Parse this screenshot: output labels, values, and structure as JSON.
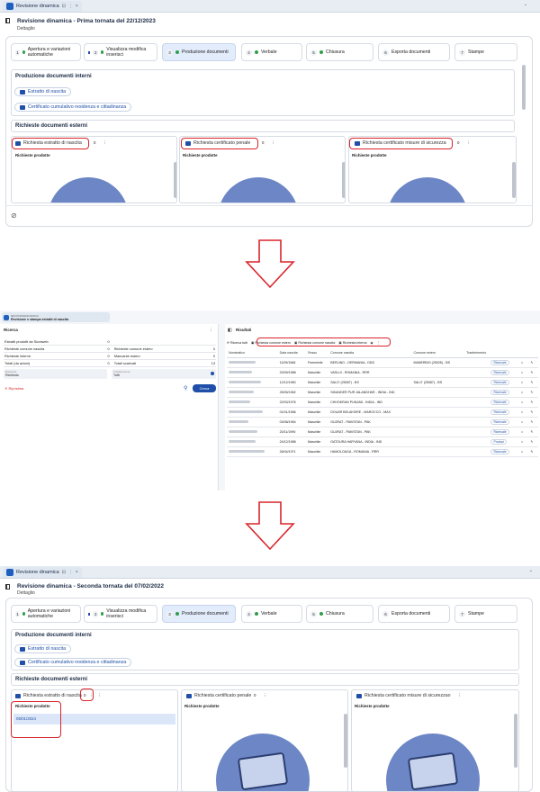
{
  "window": {
    "tab_title": "Revisione dinamica",
    "close": "×",
    "pin": "⊡",
    "more": "⋮",
    "chevron": "⌄"
  },
  "colors": {
    "accent": "#1f4fa8",
    "highlight": "#d9252c",
    "success": "#2e9d4b",
    "illustration": "#6c86c6"
  },
  "top": {
    "title": "Revisione dinamica - Prima tornata del 22/12/2023",
    "subtitle": "Dettaglio",
    "steps": [
      {
        "num": "1",
        "label": "Apertura e variazioni automatiche",
        "state": "ok"
      },
      {
        "num": "2",
        "label": "Visualizza modifica inserisci",
        "state": "ok"
      },
      {
        "num": "3",
        "label": "Produzione documenti",
        "state": "ok"
      },
      {
        "num": "4",
        "label": "Verbale",
        "state": "ok"
      },
      {
        "num": "5",
        "label": "Chiusura",
        "state": "ok"
      },
      {
        "num": "6",
        "label": "Esporta documenti",
        "state": ""
      },
      {
        "num": "7",
        "label": "Stampe",
        "state": ""
      }
    ],
    "internal_title": "Produzione documenti interni",
    "internal_buttons": [
      "Estratto di nascita",
      "Certificato cumulativo residenza e cittadinanza"
    ],
    "external_title": "Richieste documenti esterni",
    "external": [
      {
        "label": "Richiesta estratto di nascita",
        "count": "0",
        "produced": "Richieste prodotte"
      },
      {
        "label": "Richiesta certificato penale",
        "count": "0",
        "produced": "Richieste prodotte"
      },
      {
        "label": "Richiesta certificato misure di sicurezza",
        "count": "0",
        "produced": "Richieste prodotte"
      }
    ]
  },
  "middle": {
    "app_small": "REVISIONEDINAMICA",
    "app_title": "Revisione e stampa estratti di nascita",
    "search_title": "Ricerca",
    "results_title": "Risultati",
    "filters": [
      {
        "label": "Estratti prodotti da Sicraweb",
        "value": "0",
        "label2": "",
        "value2": ""
      },
      {
        "label": "Richieste comune nascita",
        "value": "0",
        "label2": "Richieste comune estero",
        "value2": "0"
      },
      {
        "label": "Richieste interne",
        "value": "0",
        "label2": "Mancante estero",
        "value2": "0"
      },
      {
        "label": "Totali (da azioni)",
        "value": "0",
        "label2": "Totali scaricati",
        "value2": "13"
      }
    ],
    "select1": {
      "label": "Richiesto",
      "value": "Richiesto"
    },
    "select2": {
      "label": "Trasferimento",
      "value": "Tutti"
    },
    "reset_label": "Ripristina",
    "search_label": "Cerca",
    "toolbar": {
      "ricercale": "Ricerca tutti",
      "btn1": "Richiesta comune estero",
      "btn2": "Richiesta comune nascita",
      "btn3": "Richiesta interna"
    },
    "columns": [
      "Nominativo",
      "Data nascita",
      "Sesso",
      "Comune nascita",
      "Comune estero",
      "Trasferimento",
      "",
      "",
      ""
    ],
    "rows": [
      {
        "date": "11/09/1966",
        "sex": "Femminile",
        "place": "BERLINO - GERMANIA - DDD",
        "estero": "MANERBIO (25025) - BS",
        "action": "Ricercale"
      },
      {
        "date": "20/09/1988",
        "sex": "Maschile",
        "place": "VASLUI - ROMANIA - RRR",
        "estero": "",
        "action": "Ricercale"
      },
      {
        "date": "12/12/1960",
        "sex": "Maschile",
        "place": "SALO' (25087) - BS",
        "estero": "SALO' (25087) - BS",
        "action": "Ricercale"
      },
      {
        "date": "25/05/1962",
        "sex": "Maschile",
        "place": "SIKANDER PUR JALANDHAR - INDIA - IND",
        "estero": "",
        "action": "Ricercale"
      },
      {
        "date": "22/03/1976",
        "sex": "Maschile",
        "place": "CHHOKRAN PUNJAB - INDIA - IND",
        "estero": "",
        "action": "Ricercale"
      },
      {
        "date": "01/01/1966",
        "sex": "Maschile",
        "place": "DOUAR BELAKSIRE - MAROCCO - MAX",
        "estero": "",
        "action": "Ricercale"
      },
      {
        "date": "03/08/1964",
        "sex": "Maschile",
        "place": "GUJRAT - PAKISTAN - PAK",
        "estero": "",
        "action": "Ricercale"
      },
      {
        "date": "20/11/1990",
        "sex": "Maschile",
        "place": "GUJRAT - PAKISTAN - PAK",
        "estero": "",
        "action": "Ricercale"
      },
      {
        "date": "24/12/1988",
        "sex": "Maschile",
        "place": "GATOURA HARYANA - INDIA - IND",
        "estero": "",
        "action": "Produci"
      },
      {
        "date": "26/04/1971",
        "sex": "Maschile",
        "place": "HAMOLOAGA - ROMANIA - RRR",
        "estero": "",
        "action": "Ricercale"
      }
    ]
  },
  "bottom": {
    "title": "Revisione dinamica - Seconda tornata del 07/02/2022",
    "subtitle": "Dettaglio",
    "steps": [
      {
        "num": "1",
        "label": "Apertura e variazioni automatiche"
      },
      {
        "num": "2",
        "label": "Visualizza modifica inserisci"
      },
      {
        "num": "3",
        "label": "Produzione documenti"
      },
      {
        "num": "4",
        "label": "Verbale"
      },
      {
        "num": "5",
        "label": "Chiusura"
      },
      {
        "num": "6",
        "label": "Esporta documenti"
      },
      {
        "num": "7",
        "label": "Stampe"
      }
    ],
    "internal_title": "Produzione documenti interni",
    "internal_buttons": [
      "Estratto di nascita",
      "Certificato cumulativo residenza e cittadinanza"
    ],
    "external_title": "Richieste documenti esterni",
    "external": [
      {
        "label": "Richiesta estratto di nascita",
        "count": "0",
        "produced": "Richieste prodotte"
      },
      {
        "label": "Richiesta certificato penale",
        "count": "0",
        "produced": "Richieste prodotte"
      },
      {
        "label": "Richiesta certificato misure di sicurezza",
        "count": "0",
        "produced": "Richieste prodotte"
      }
    ],
    "produced_date": "05/01/2024"
  }
}
